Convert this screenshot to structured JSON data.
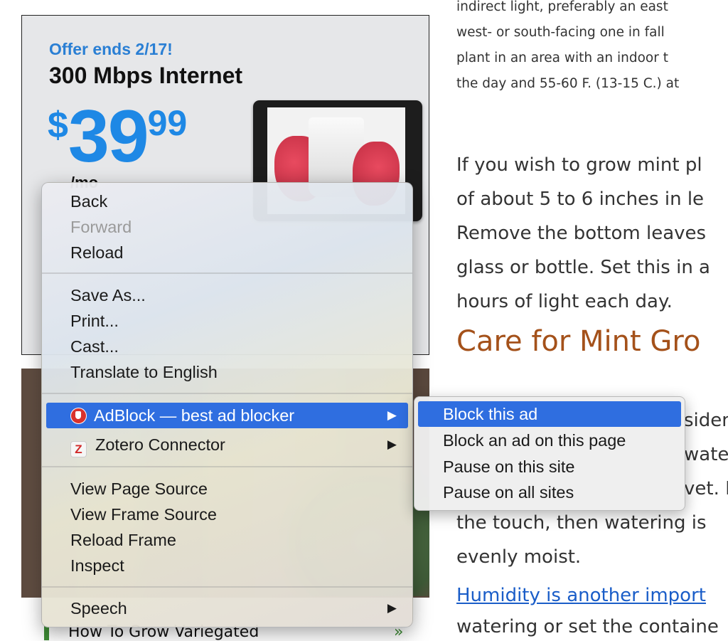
{
  "ad": {
    "offer": "Offer ends 2/17!",
    "speed": "300 Mbps Internet",
    "price_currency": "$",
    "price_dollars": "39",
    "price_cents": "99",
    "per": "/mo"
  },
  "article": {
    "para1_lines": [
      "indirect light, preferably an east",
      "west- or south-facing one in fall",
      "plant in an area with an indoor t",
      "the day and 55-60 F. (13-15 C.) at"
    ],
    "para2_lines": [
      "If you wish to grow mint pl",
      "of about 5 to 6 inches in le",
      "Remove the bottom leaves",
      "glass or bottle. Set this in a",
      "hours of light each day."
    ],
    "heading": "Care for Mint Gro",
    "para3_lines": [
      "siden",
      "wate",
      "vet. If",
      "the touch, then watering is",
      "evenly moist."
    ],
    "link": "Humidity is another import",
    "para4": "watering or set the containe"
  },
  "related": {
    "text": "How To Grow Variegated",
    "arrow": "»"
  },
  "context_menu": {
    "items": [
      {
        "label": "Back",
        "enabled": true
      },
      {
        "label": "Forward",
        "enabled": false
      },
      {
        "label": "Reload",
        "enabled": true
      },
      {
        "label": "Save As...",
        "enabled": true
      },
      {
        "label": "Print...",
        "enabled": true
      },
      {
        "label": "Cast...",
        "enabled": true
      },
      {
        "label": "Translate to English",
        "enabled": true
      },
      {
        "label": "AdBlock — best ad blocker",
        "icon": "adblock-hand-icon",
        "submenu": true,
        "highlighted": true
      },
      {
        "label": "Zotero Connector",
        "icon": "zotero-z-icon",
        "submenu": true
      },
      {
        "label": "View Page Source",
        "enabled": true
      },
      {
        "label": "View Frame Source",
        "enabled": true
      },
      {
        "label": "Reload Frame",
        "enabled": true
      },
      {
        "label": "Inspect",
        "enabled": true
      },
      {
        "label": "Speech",
        "submenu": true
      }
    ],
    "submenu_arrow": "▶"
  },
  "adblock_submenu": {
    "items": [
      {
        "label": "Block this ad",
        "highlighted": true
      },
      {
        "label": "Block an ad on this page"
      },
      {
        "label": "Pause on this site"
      },
      {
        "label": "Pause on all sites"
      }
    ]
  },
  "colors": {
    "highlight": "#2f6ee0",
    "heading": "#a4511a",
    "link": "#1a5dc8",
    "offer": "#2a7fd4",
    "price": "#1e88e5"
  }
}
